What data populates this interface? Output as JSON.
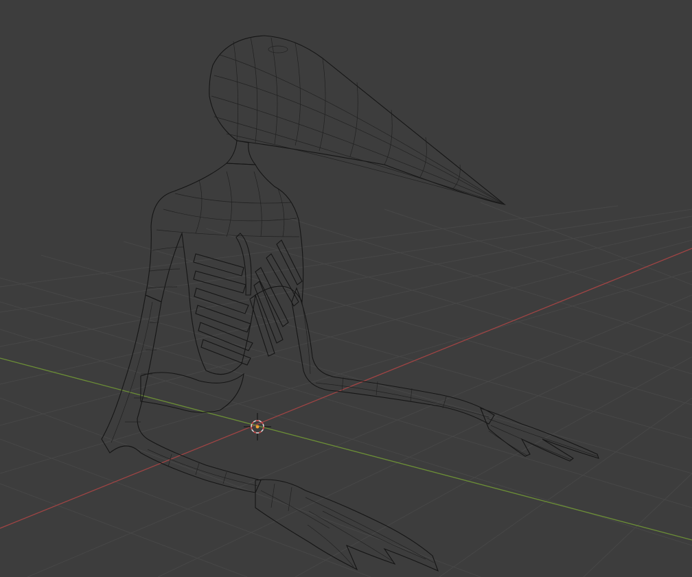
{
  "viewport": {
    "background_color": "#3d3d3d",
    "grid_color": "#474747",
    "x_axis_color": "#a04444",
    "y_axis_color": "#6c8f36",
    "mesh_color": "#3a3a3a",
    "wire_color": "#151515",
    "cursor_color": "#d9d9d9",
    "cursor_dash_color": "#c94040",
    "origin_color": "#f0a030",
    "view_mode": "wireframe"
  }
}
